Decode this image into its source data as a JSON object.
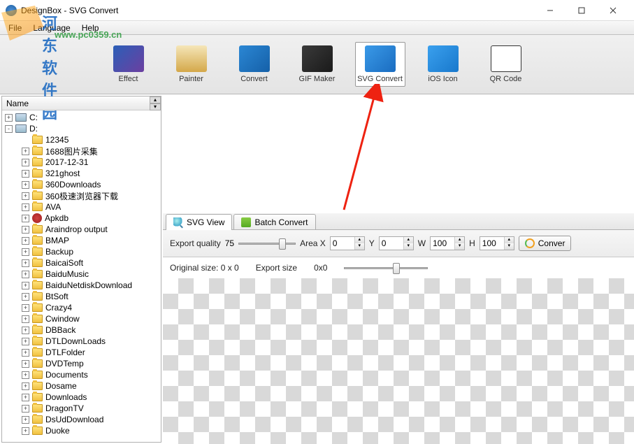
{
  "window": {
    "title": "DesignBox - SVG Convert"
  },
  "menu": {
    "file": "File",
    "language": "Language",
    "help": "Help"
  },
  "watermark": {
    "line1": "河东软件园",
    "line2": "www.pc0359.cn"
  },
  "toolbar": [
    {
      "label": "Effect",
      "icon": "ic-effect",
      "selected": false
    },
    {
      "label": "Painter",
      "icon": "ic-painter",
      "selected": false
    },
    {
      "label": "Convert",
      "icon": "ic-convert",
      "selected": false
    },
    {
      "label": "GIF Maker",
      "icon": "ic-gif",
      "selected": false
    },
    {
      "label": "SVG Convert",
      "icon": "ic-svg",
      "selected": true
    },
    {
      "label": "iOS Icon",
      "icon": "ic-ios",
      "selected": false
    },
    {
      "label": "QR Code",
      "icon": "ic-qr",
      "selected": false
    }
  ],
  "sidebar": {
    "header": "Name",
    "drives": [
      {
        "label": "C:",
        "expander": "+"
      },
      {
        "label": "D:",
        "expander": "-"
      }
    ],
    "folders": [
      "12345",
      "1688图片采集",
      "2017-12-31",
      "321ghost",
      "360Downloads",
      "360极速浏览器下载",
      "AVA",
      "Apkdb",
      "Araindrop output",
      "BMAP",
      "Backup",
      "BaicaiSoft",
      "BaiduMusic",
      "BaiduNetdiskDownload",
      "BtSoft",
      "Crazy4",
      "Cwindow",
      "DBBack",
      "DTLDownLoads",
      "DTLFolder",
      "DVDTemp",
      "Documents",
      "Dosame",
      "Downloads",
      "DragonTV",
      "DsUdDownload",
      "Duoke"
    ]
  },
  "tabs": {
    "svg_view": "SVG View",
    "batch": "Batch Convert"
  },
  "export": {
    "quality_label": "Export quality",
    "quality_value": "75",
    "area_label": "Area X",
    "x": "0",
    "y_label": "Y",
    "y": "0",
    "w_label": "W",
    "w": "100",
    "h_label": "H",
    "h": "100",
    "convert_btn": "Conver"
  },
  "info": {
    "original_label": "Original size:",
    "original_value": "0 x 0",
    "export_label": "Export size",
    "export_value": "0x0"
  }
}
